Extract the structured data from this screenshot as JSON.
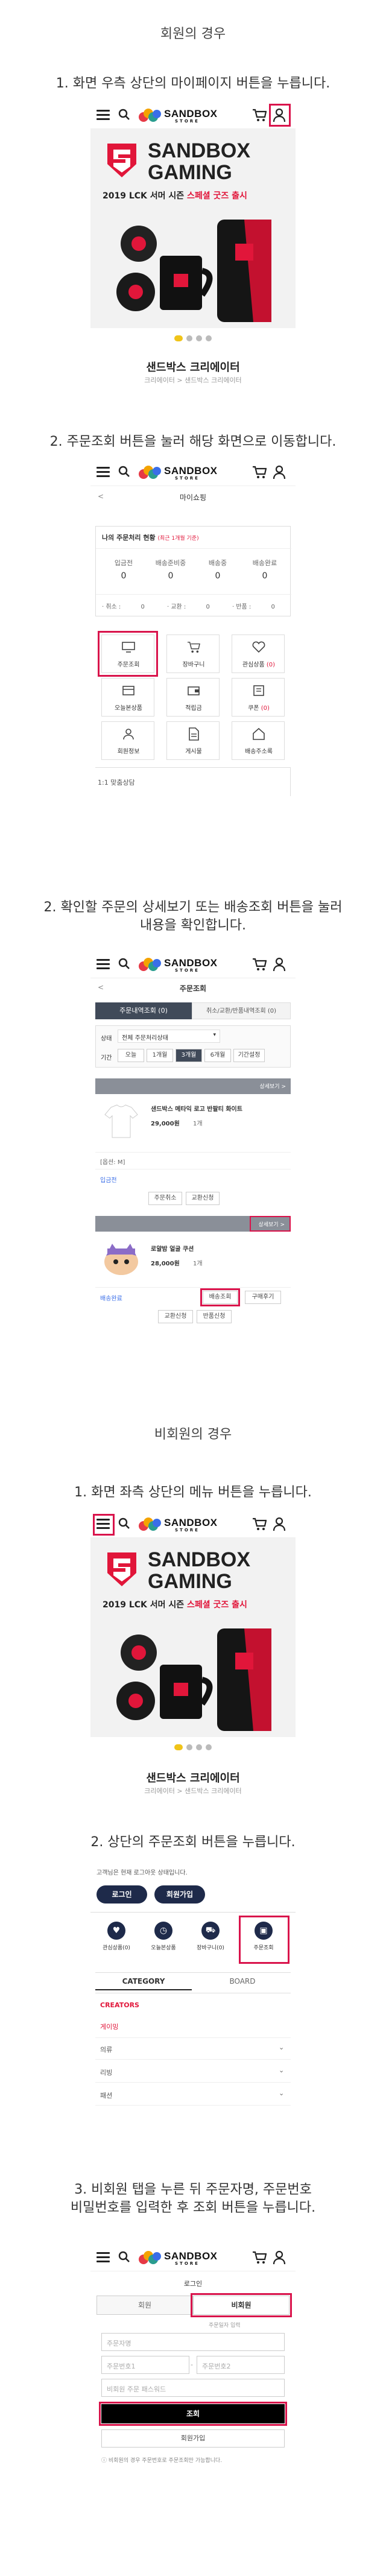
{
  "member": {
    "section_title": "회원의 경우",
    "step1": "1. 화면 우측 상단의 마이페이지 버튼을 누릅니다.",
    "step2": "2. 주문조회 버튼을 눌러 해당 화면으로 이동합니다.",
    "step3_line1": "2. 확인할 주문의 상세보기 또는 배송조회 버튼을 눌러",
    "step3_line2": "내용을 확인합니다."
  },
  "nonmember": {
    "section_title": "비회원의 경우",
    "step1": "1. 화면 좌측 상단의 메뉴 버튼을 누릅니다.",
    "step2": "2. 상단의 주문조회 버튼을 누릅니다.",
    "step3_line1": "3. 비회원 탭을 누른 뒤 주문자명, 주문번호",
    "step3_line2": "비밀번호를 입력한 후 조회 버튼을 누릅니다."
  },
  "header": {
    "logo_main": "SANDBOX",
    "logo_sub": "STORE"
  },
  "banner": {
    "title_line1": "SANDBOX",
    "title_line2": "GAMING",
    "sub_prefix": "2019 LCK 서머 시즌 ",
    "sub_highlight": "스페셜 굿즈 출시"
  },
  "creator": {
    "name": "샌드박스 크리에이터",
    "breadcrumb": "크리에이터 > 샌드박스 크리에이터"
  },
  "mypage": {
    "title": "마이쇼핑",
    "status_title": "나의 주문처리 현황",
    "status_note": "(최근 1개월 기준)",
    "cols": [
      {
        "label": "입금전",
        "value": "0"
      },
      {
        "label": "배송준비중",
        "value": "0"
      },
      {
        "label": "배송중",
        "value": "0"
      },
      {
        "label": "배송완료",
        "value": "0"
      }
    ],
    "cancel": "· 취소 :",
    "cancel_v": "0",
    "exchange": "· 교환 :",
    "exchange_v": "0",
    "return": "· 반품 :",
    "return_v": "0",
    "menu": [
      "주문조회",
      "장바구니",
      "관심상품",
      "오늘본상품",
      "적립금",
      "쿠폰",
      "회원정보",
      "게시물",
      "배송주소록"
    ],
    "wish_count": "(0)",
    "coupon_count": "(0)",
    "qa": "1:1 맞춤상담"
  },
  "orders": {
    "title": "주문조회",
    "tab1": "주문내역조회 (0)",
    "tab2": "취소/교환/반품내역조회 (0)",
    "status_label": "상태",
    "status_value": "전체 주문처리상태",
    "period_label": "기간",
    "periods": [
      "오늘",
      "1개월",
      "3개월",
      "6개월",
      "기간설정"
    ],
    "detail": "상세보기 >",
    "item1_name": "샌드박스 메타익 로고 반팔티 화이트",
    "item1_price": "29,000원",
    "item1_qty": "1개",
    "item1_option": "[옵션: M]",
    "item1_status": "입금전",
    "btn_cancel": "주문취소",
    "btn_exchange": "교환신청",
    "item2_name": "로얄밤 얼굴 쿠션",
    "item2_price": "28,000원",
    "item2_qty": "1개",
    "item2_status": "배송완료",
    "btn_track": "배송조회",
    "btn_review": "구매후기",
    "btn_exchange2": "교환신청",
    "btn_return": "반품신청"
  },
  "sidemenu": {
    "greeting": "고객님은 현재 로그아웃 상태입니다.",
    "login": "로그인",
    "join": "회원가입",
    "icons": [
      "관심상품(0)",
      "오늘본상품",
      "장바구니(0)",
      "주문조회"
    ],
    "tab_category": "CATEGORY",
    "tab_board": "BOARD",
    "cat_creators": "CREATORS",
    "cat_gamer": "게이밍",
    "items": [
      "의류",
      "리빙",
      "패션"
    ]
  },
  "login": {
    "title": "로그인",
    "tab_member": "회원",
    "tab_guest": "비회원",
    "date_label": "주문일자 입력",
    "name_ph": "주문자명",
    "num1_ph": "주문번호1",
    "num2_ph": "주문번호2",
    "pw_ph": "비회원 주문 패스워드",
    "submit": "조회",
    "join": "회원가입",
    "notice": "비회원의 경우 주문번호로 주문조회만 가능합니다."
  },
  "colors": {
    "accent": "#d9134b",
    "dark": "#1e2a4a",
    "tab": "#404a59"
  }
}
